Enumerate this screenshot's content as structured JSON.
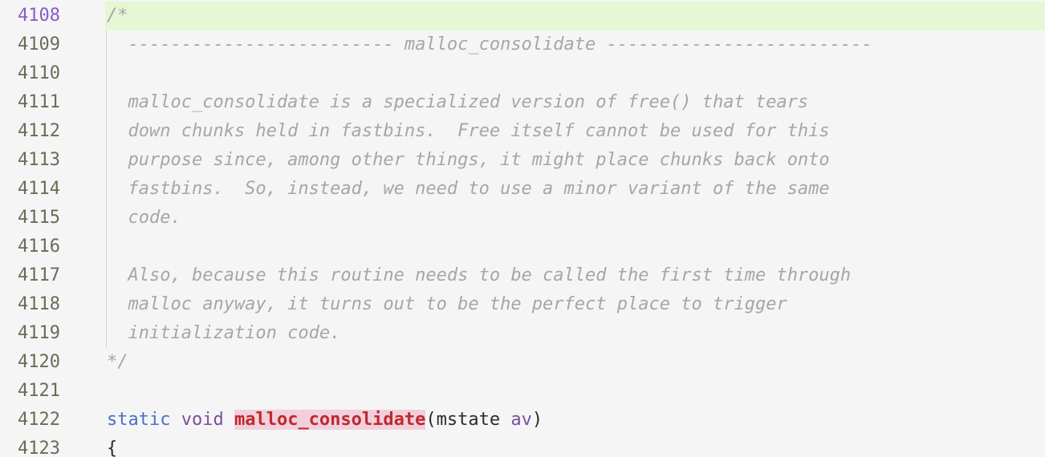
{
  "editor": {
    "current_line": 4108,
    "lines": [
      {
        "num": "4108",
        "text": "/*"
      },
      {
        "num": "4109",
        "text": "  ------------------------- malloc_consolidate -------------------------"
      },
      {
        "num": "4110",
        "text": ""
      },
      {
        "num": "4111",
        "text": "  malloc_consolidate is a specialized version of free() that tears"
      },
      {
        "num": "4112",
        "text": "  down chunks held in fastbins.  Free itself cannot be used for this"
      },
      {
        "num": "4113",
        "text": "  purpose since, among other things, it might place chunks back onto"
      },
      {
        "num": "4114",
        "text": "  fastbins.  So, instead, we need to use a minor variant of the same"
      },
      {
        "num": "4115",
        "text": "  code."
      },
      {
        "num": "4116",
        "text": ""
      },
      {
        "num": "4117",
        "text": "  Also, because this routine needs to be called the first time through"
      },
      {
        "num": "4118",
        "text": "  malloc anyway, it turns out to be the perfect place to trigger"
      },
      {
        "num": "4119",
        "text": "  initialization code."
      },
      {
        "num": "4120",
        "text": "*/"
      },
      {
        "num": "4121",
        "text": ""
      },
      {
        "num": "4122",
        "tokens": {
          "kw1": "static",
          "kw2": "void",
          "fn": "malloc_consolidate",
          "paren_open": "(",
          "type": "mstate",
          "param": "av",
          "paren_close": ")"
        }
      },
      {
        "num": "4123",
        "text": "{"
      }
    ]
  },
  "colors": {
    "background": "#f5f5f5",
    "current_line_bg": "#e5f7d4",
    "comment": "#a6a6a6",
    "keyword_blue": "#4d6fc4",
    "keyword_purple": "#7b4f9e",
    "function_name": "#c0282f",
    "function_highlight": "#f1d0dc",
    "line_number": "#6b6b58",
    "line_number_current": "#8a5cc9"
  }
}
